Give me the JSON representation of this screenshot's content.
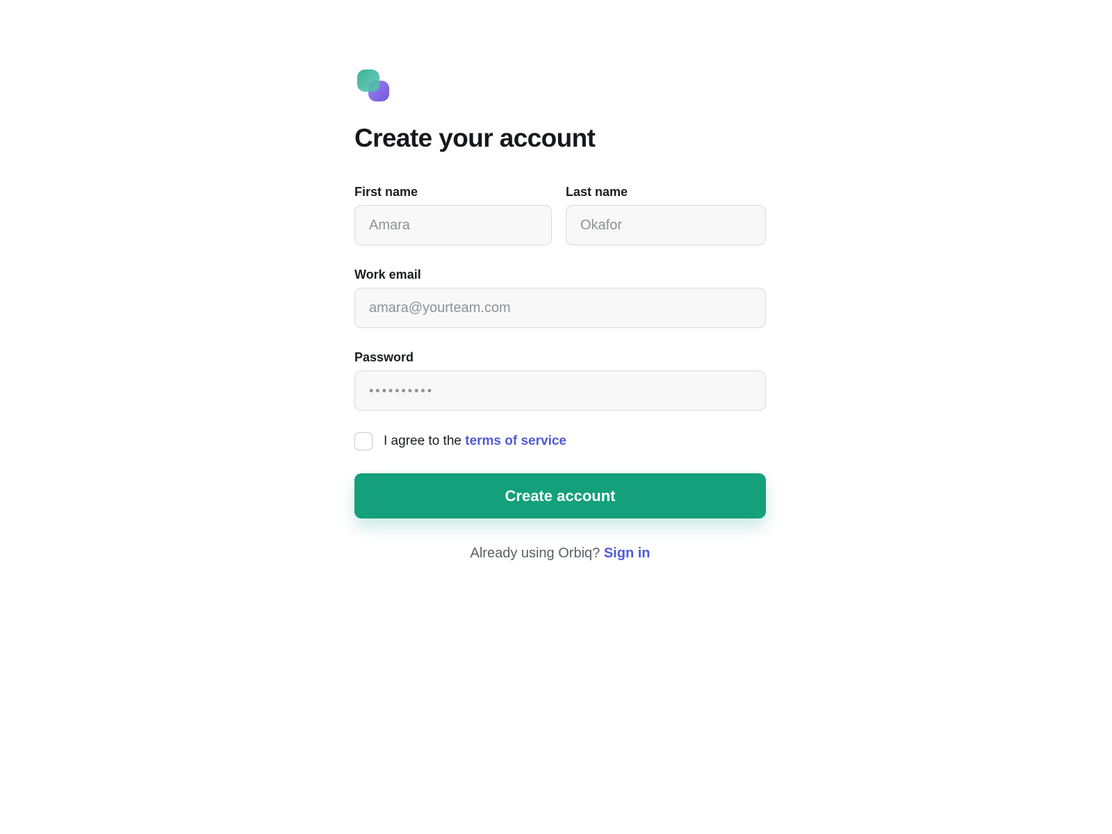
{
  "brand": {
    "logo_icon": "orbiq-logo-icon",
    "colors": {
      "primary": "#13a07b",
      "link": "#4f5bd5",
      "logo_teal": "#2bb59c",
      "logo_violet": "#8a6ee6"
    }
  },
  "page": {
    "title": "Create your account"
  },
  "form": {
    "first_name": {
      "label": "First name",
      "placeholder": "Amara",
      "value": ""
    },
    "last_name": {
      "label": "Last name",
      "placeholder": "Okafor",
      "value": ""
    },
    "email": {
      "label": "Work email",
      "placeholder": "amara@yourteam.com",
      "value": ""
    },
    "password": {
      "label": "Password",
      "placeholder": "••••••••••",
      "value": ""
    },
    "terms": {
      "checked": false,
      "prefix": "I agree to the ",
      "link_text": "terms of service"
    },
    "submit_label": "Create account"
  },
  "footer": {
    "prompt": "Already using Orbiq? ",
    "link_text": "Sign in"
  }
}
